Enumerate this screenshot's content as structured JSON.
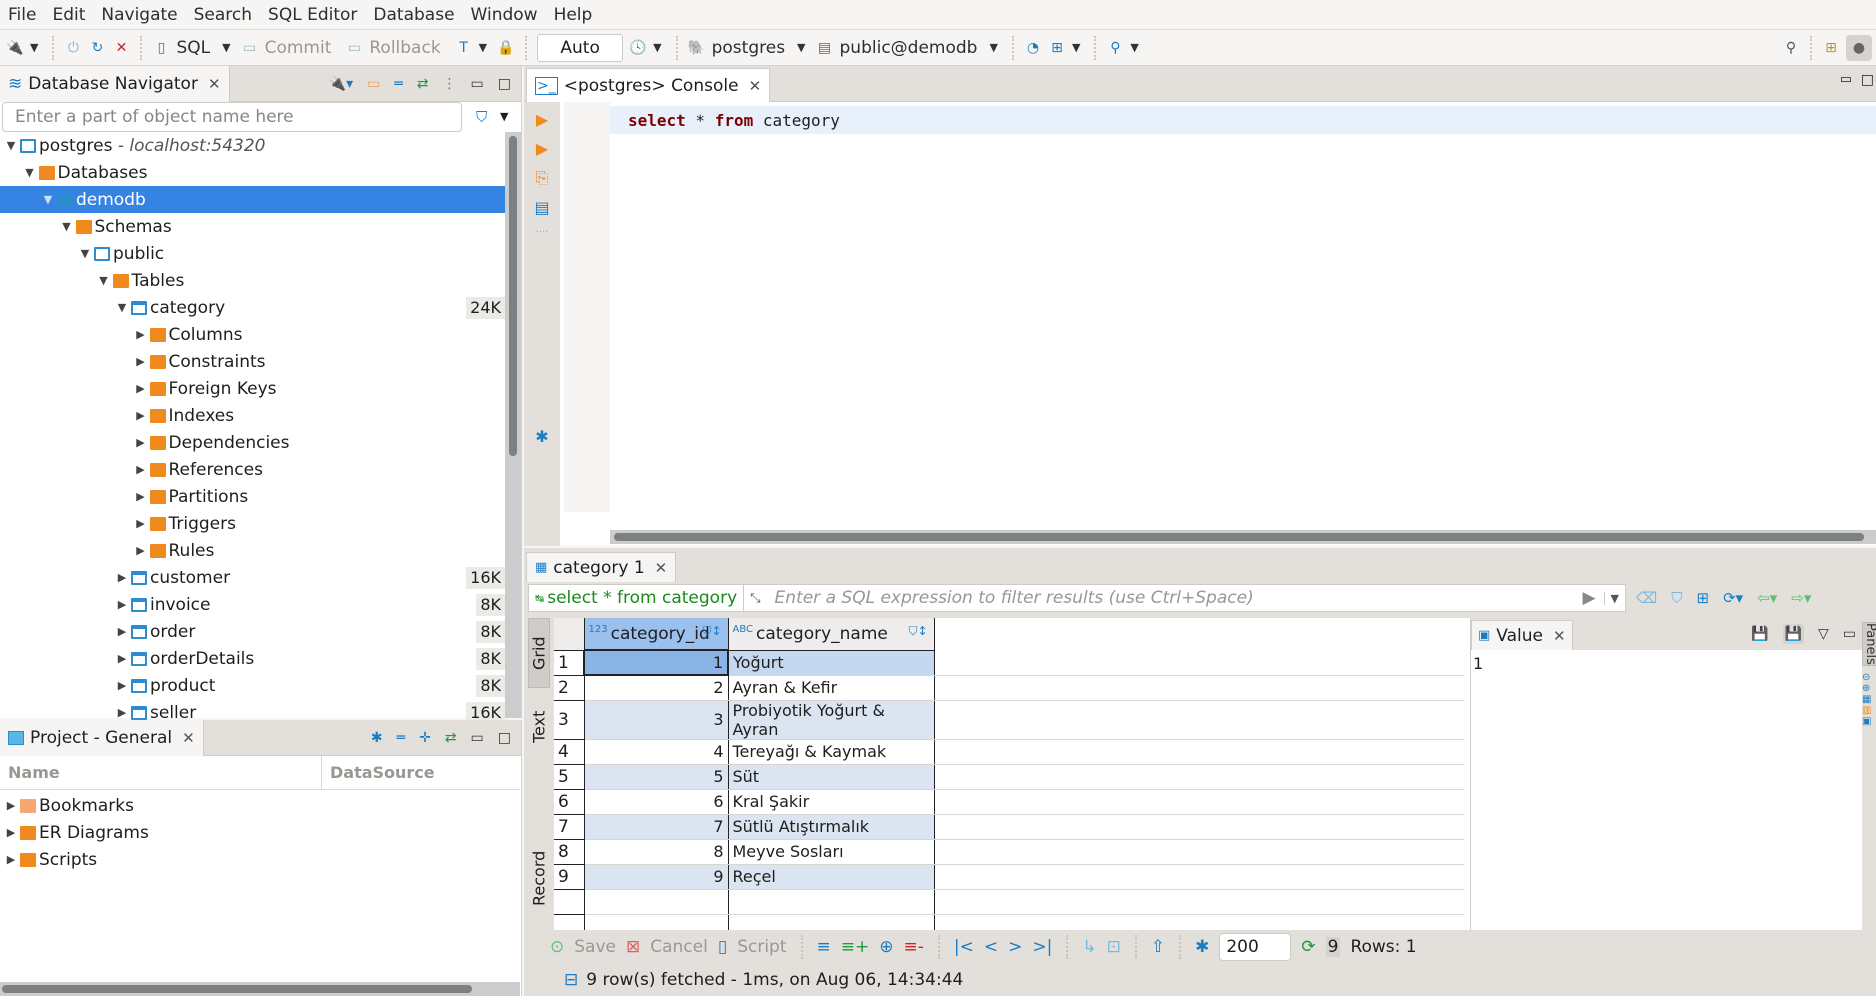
{
  "menu": [
    "File",
    "Edit",
    "Navigate",
    "Search",
    "SQL Editor",
    "Database",
    "Window",
    "Help"
  ],
  "toolbar": {
    "sql_label": "SQL",
    "commit_label": "Commit",
    "rollback_label": "Rollback",
    "transaction_mode": "Auto",
    "datasource": "postgres",
    "schema": "public@demodb"
  },
  "navigator": {
    "title": "Database Navigator",
    "search_placeholder": "Enter a part of object name here",
    "tree": [
      {
        "label": "postgres",
        "sublabel": " - localhost:54320",
        "depth": 0,
        "icon": "connection",
        "expanded": true
      },
      {
        "label": "Databases",
        "depth": 1,
        "icon": "folder",
        "expanded": true
      },
      {
        "label": "demodb",
        "depth": 2,
        "icon": "database",
        "expanded": true,
        "selected": true
      },
      {
        "label": "Schemas",
        "depth": 3,
        "icon": "schema",
        "expanded": true
      },
      {
        "label": "public",
        "depth": 4,
        "icon": "doc",
        "expanded": true
      },
      {
        "label": "Tables",
        "depth": 5,
        "icon": "folder",
        "expanded": true
      },
      {
        "label": "category",
        "depth": 6,
        "icon": "table",
        "expanded": true,
        "size": "24K"
      },
      {
        "label": "Columns",
        "depth": 7,
        "icon": "folder",
        "expanded": false
      },
      {
        "label": "Constraints",
        "depth": 7,
        "icon": "folder",
        "expanded": false
      },
      {
        "label": "Foreign Keys",
        "depth": 7,
        "icon": "folder",
        "expanded": false
      },
      {
        "label": "Indexes",
        "depth": 7,
        "icon": "folder",
        "expanded": false
      },
      {
        "label": "Dependencies",
        "depth": 7,
        "icon": "folder",
        "expanded": false
      },
      {
        "label": "References",
        "depth": 7,
        "icon": "folder",
        "expanded": false
      },
      {
        "label": "Partitions",
        "depth": 7,
        "icon": "folder",
        "expanded": false
      },
      {
        "label": "Triggers",
        "depth": 7,
        "icon": "folder",
        "expanded": false
      },
      {
        "label": "Rules",
        "depth": 7,
        "icon": "folder",
        "expanded": false
      },
      {
        "label": "customer",
        "depth": 6,
        "icon": "table",
        "expanded": false,
        "size": "16K"
      },
      {
        "label": "invoice",
        "depth": 6,
        "icon": "table",
        "expanded": false,
        "size": "8K"
      },
      {
        "label": "order",
        "depth": 6,
        "icon": "table",
        "expanded": false,
        "size": "8K"
      },
      {
        "label": "orderDetails",
        "depth": 6,
        "icon": "table",
        "expanded": false,
        "size": "8K"
      },
      {
        "label": "product",
        "depth": 6,
        "icon": "table",
        "expanded": false,
        "size": "8K"
      },
      {
        "label": "seller",
        "depth": 6,
        "icon": "table",
        "expanded": false,
        "size": "16K"
      }
    ]
  },
  "project": {
    "title": "Project - General",
    "columns": [
      "Name",
      "DataSource"
    ],
    "items": [
      "Bookmarks",
      "ER Diagrams",
      "Scripts"
    ]
  },
  "editor": {
    "tab_title": "<postgres> Console",
    "code": {
      "kw1": "select",
      "mid": " * ",
      "kw2": "from",
      "rest": " category"
    }
  },
  "results": {
    "tab_title": "category 1",
    "query": "select * from category",
    "filter_placeholder": "Enter a SQL expression to filter results (use Ctrl+Space)",
    "side_tabs": [
      "Grid",
      "Text",
      "Record"
    ],
    "columns": [
      {
        "name": "category_id",
        "type_icon": "123"
      },
      {
        "name": "category_name",
        "type_icon": "ABC"
      }
    ],
    "rows": [
      {
        "n": "1",
        "id": "1",
        "name": "Yoğurt"
      },
      {
        "n": "2",
        "id": "2",
        "name": "Ayran & Kefir"
      },
      {
        "n": "3",
        "id": "3",
        "name": "Probiyotik Yoğurt & Ayran"
      },
      {
        "n": "4",
        "id": "4",
        "name": "Tereyağı & Kaymak"
      },
      {
        "n": "5",
        "id": "5",
        "name": "Süt"
      },
      {
        "n": "6",
        "id": "6",
        "name": "Kral Şakir"
      },
      {
        "n": "7",
        "id": "7",
        "name": "Sütlü Atıştırmalık"
      },
      {
        "n": "8",
        "id": "8",
        "name": "Meyve Sosları"
      },
      {
        "n": "9",
        "id": "9",
        "name": "Reçel"
      }
    ],
    "value_panel": {
      "title": "Value",
      "content": "1"
    },
    "panels_label": "Panels",
    "bottom": {
      "save": "Save",
      "cancel": "Cancel",
      "script": "Script",
      "fetch_size": "200",
      "row_count": "9",
      "rows_label": "Rows: 1"
    },
    "status": "9 row(s) fetched - 1ms, on Aug 06, 14:34:44"
  }
}
